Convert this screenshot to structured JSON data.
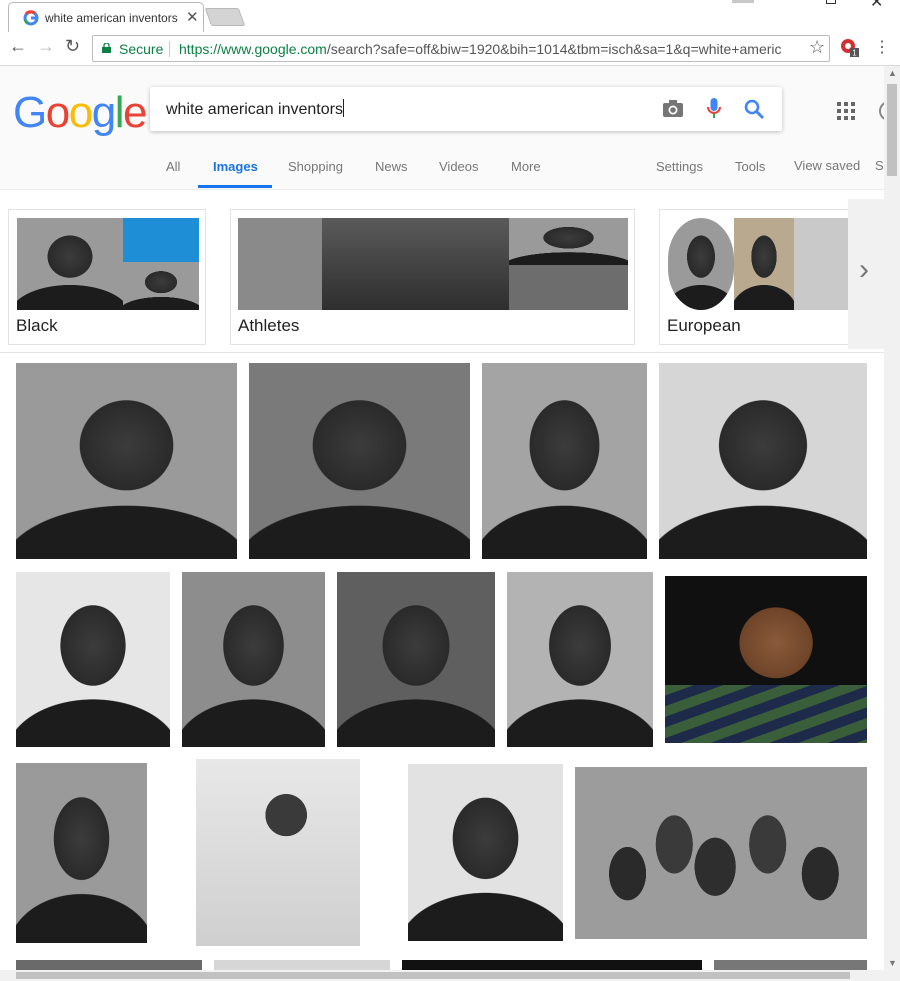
{
  "browser": {
    "tab_title": "white american inventors",
    "secure_label": "Secure",
    "url_host": "https://www.google.com",
    "url_rest": "/search?safe=off&biw=1920&bih=1014&tbm=isch&sa=1&q=white+americ",
    "extension_badge": "1"
  },
  "header": {
    "search_query": "white american inventors",
    "tabs": [
      "All",
      "Images",
      "Shopping",
      "News",
      "Videos",
      "More"
    ],
    "tools": [
      "Settings",
      "Tools",
      "View saved",
      "S"
    ]
  },
  "chips": [
    {
      "label": "Black"
    },
    {
      "label": "Athletes"
    },
    {
      "label": "European"
    }
  ],
  "colors": {
    "google_blue": "#4285F4",
    "google_red": "#EA4335",
    "google_yellow": "#FBBC05",
    "google_green": "#34A853",
    "secure_green": "#0b8043",
    "active_tab": "#1a73e8"
  }
}
